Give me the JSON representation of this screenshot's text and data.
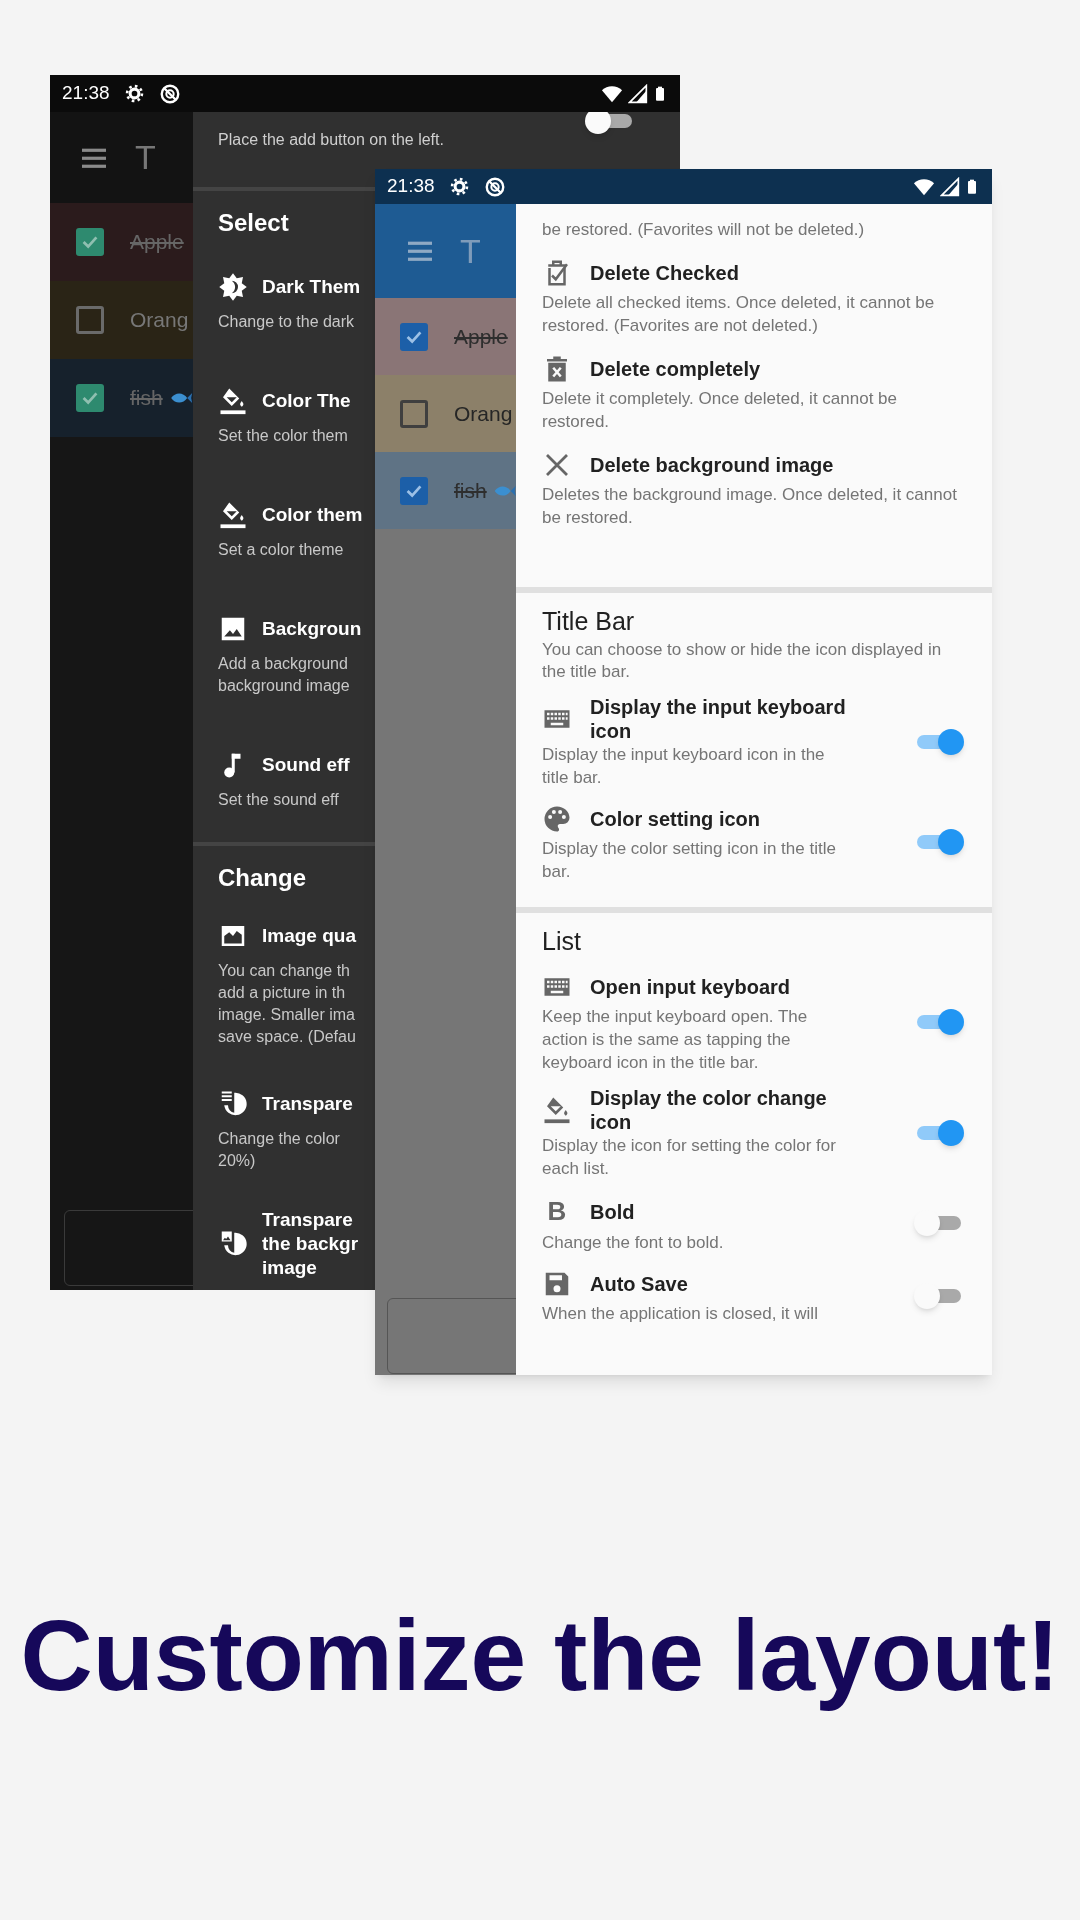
{
  "back_screen": {
    "status_bar": {
      "time": "21:38"
    },
    "app_bar": {
      "title": "T"
    },
    "list": [
      {
        "text": "Apple",
        "checked": true,
        "color": "#2b1b1c"
      },
      {
        "text": "Orang",
        "checked": false,
        "color": "#2a2416"
      },
      {
        "text": "fish",
        "checked": true,
        "color": "#16212c"
      }
    ],
    "drawer": {
      "top_item": {
        "description": "Place the add button on the left.",
        "on": false
      },
      "sections": [
        {
          "heading": "Select",
          "items": [
            {
              "title_lines": [
                "Dark Them"
              ],
              "description_lines": [
                "Change to the dark"
              ]
            },
            {
              "title_lines": [
                "Color The"
              ],
              "description_lines": [
                "Set the color them"
              ]
            },
            {
              "title_lines": [
                "Color them"
              ],
              "description_lines": [
                "Set a color theme"
              ]
            },
            {
              "title_lines": [
                "Backgroun"
              ],
              "description_lines": [
                "Add a background",
                "background image"
              ]
            },
            {
              "title_lines": [
                "Sound eff"
              ],
              "description_lines": [
                "Set the sound eff"
              ]
            }
          ]
        },
        {
          "heading": "Change",
          "items": [
            {
              "title_lines": [
                "Image qua"
              ],
              "description_lines": [
                "You can change th",
                "add a picture in th",
                "image. Smaller ima",
                "save space. (Defau"
              ]
            },
            {
              "title_lines": [
                "Transpare"
              ],
              "description_lines": [
                "Change the color",
                "20%)"
              ]
            },
            {
              "title_lines": [
                "Transpare",
                "the backgr",
                "image"
              ]
            }
          ]
        }
      ]
    }
  },
  "front_screen": {
    "status_bar": {
      "time": "21:38"
    },
    "app_bar": {
      "title": "T"
    },
    "list": [
      {
        "text": "Apple",
        "checked": true,
        "color": "#8a7576"
      },
      {
        "text": "Orang",
        "checked": false,
        "color": "#8c8069"
      },
      {
        "text": "fish",
        "checked": true,
        "color": "#5f7385"
      }
    ],
    "panel": {
      "lead": "be restored. (Favorites will not be deleted.)",
      "sections": [
        {
          "items": [
            {
              "kind": "action",
              "title": "Delete Checked",
              "description": "Delete all checked items. Once deleted, it cannot be restored. (Favorites are not deleted.)"
            },
            {
              "kind": "action",
              "title": "Delete completely",
              "description": "Delete it completely. Once deleted, it cannot be restored."
            },
            {
              "kind": "action",
              "title": "Delete background image",
              "description": "Deletes the background image. Once deleted, it cannot be restored."
            }
          ]
        },
        {
          "heading": "Title Bar",
          "description": "You can choose to show or hide the icon displayed in the title bar.",
          "items": [
            {
              "kind": "switch",
              "title": "Display the input keyboard icon",
              "description": "Display the input keyboard icon in the title bar.",
              "on": true
            },
            {
              "kind": "switch",
              "title": "Color setting icon",
              "description": "Display the color setting icon in the title bar.",
              "on": true
            }
          ]
        },
        {
          "heading": "List",
          "items": [
            {
              "kind": "switch",
              "title": "Open input keyboard",
              "description": "Keep the input keyboard open. The action is the same as tapping the keyboard icon in the title bar.",
              "on": true
            },
            {
              "kind": "switch",
              "title": "Display the color change icon",
              "description": "Display the icon for setting the color for each list.",
              "on": true
            },
            {
              "kind": "switch",
              "title": "Bold",
              "description": "Change the font to bold.",
              "on": false,
              "icon_text": "B"
            },
            {
              "kind": "switch",
              "title": "Auto Save",
              "description": "When the application is closed, it will",
              "on": false
            }
          ]
        }
      ]
    }
  },
  "caption": "Customize the layout!"
}
